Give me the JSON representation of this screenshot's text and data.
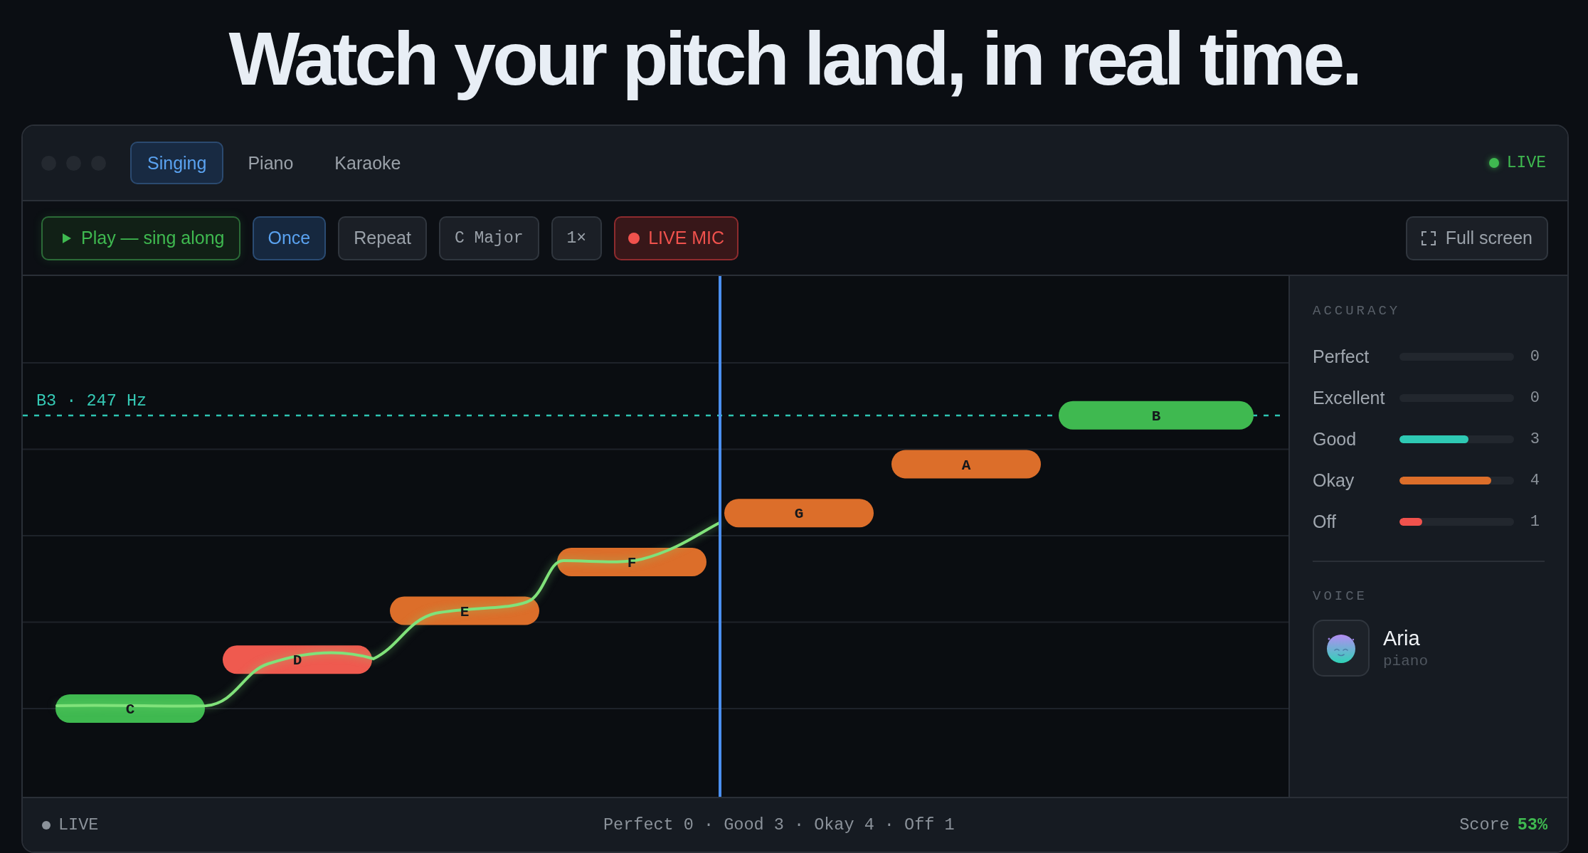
{
  "headline": "Watch your pitch land, in real time.",
  "window": {
    "tabs": [
      {
        "label": "Singing",
        "selected": true
      },
      {
        "label": "Piano",
        "selected": false
      },
      {
        "label": "Karaoke",
        "selected": false
      }
    ],
    "live_label": "LIVE"
  },
  "toolbar": {
    "play_button": "Play — sing along",
    "loop_modes": [
      {
        "label": "Once",
        "selected": true
      },
      {
        "label": "Repeat",
        "selected": false
      }
    ],
    "key": "C Major",
    "speed": "1×",
    "live_mic": {
      "label": "LIVE MIC",
      "on": true
    },
    "fullscreen_button": "Full screen"
  },
  "chart": {
    "target_label": "B3 · 247 Hz",
    "notes": [
      {
        "label": "C",
        "color": "#3fb950",
        "long": false
      },
      {
        "label": "D",
        "color": "#ef5a4f",
        "long": false
      },
      {
        "label": "E",
        "color": "#dc6e2a",
        "long": false
      },
      {
        "label": "F",
        "color": "#dc6e2a",
        "long": false
      },
      {
        "label": "G",
        "color": "#dc6e2a",
        "long": false
      },
      {
        "label": "A",
        "color": "#dc6e2a",
        "long": false
      },
      {
        "label": "B",
        "color": "#3fb950",
        "long": true
      }
    ]
  },
  "accuracy": {
    "title": "ACCURACY",
    "rows": [
      {
        "label": "Perfect",
        "count": "0"
      },
      {
        "label": "Excellent",
        "count": "0"
      },
      {
        "label": "Good",
        "level": 0.6,
        "count": "3",
        "color": "#2ec9b4"
      },
      {
        "label": "Okay",
        "level": 0.8,
        "count": "4",
        "color": "#dc6e2a"
      },
      {
        "label": "Off",
        "level": 0.2,
        "count": "1",
        "color": "#f0524d"
      }
    ]
  },
  "voice": {
    "title": "VOICE",
    "name": "Aria",
    "instrument": "piano"
  },
  "status_bar": {
    "live_label": "LIVE",
    "summary": "Perfect 0 · Good 3 · Okay 4 · Off 1",
    "score_label": "Score",
    "score_value": "53%"
  }
}
